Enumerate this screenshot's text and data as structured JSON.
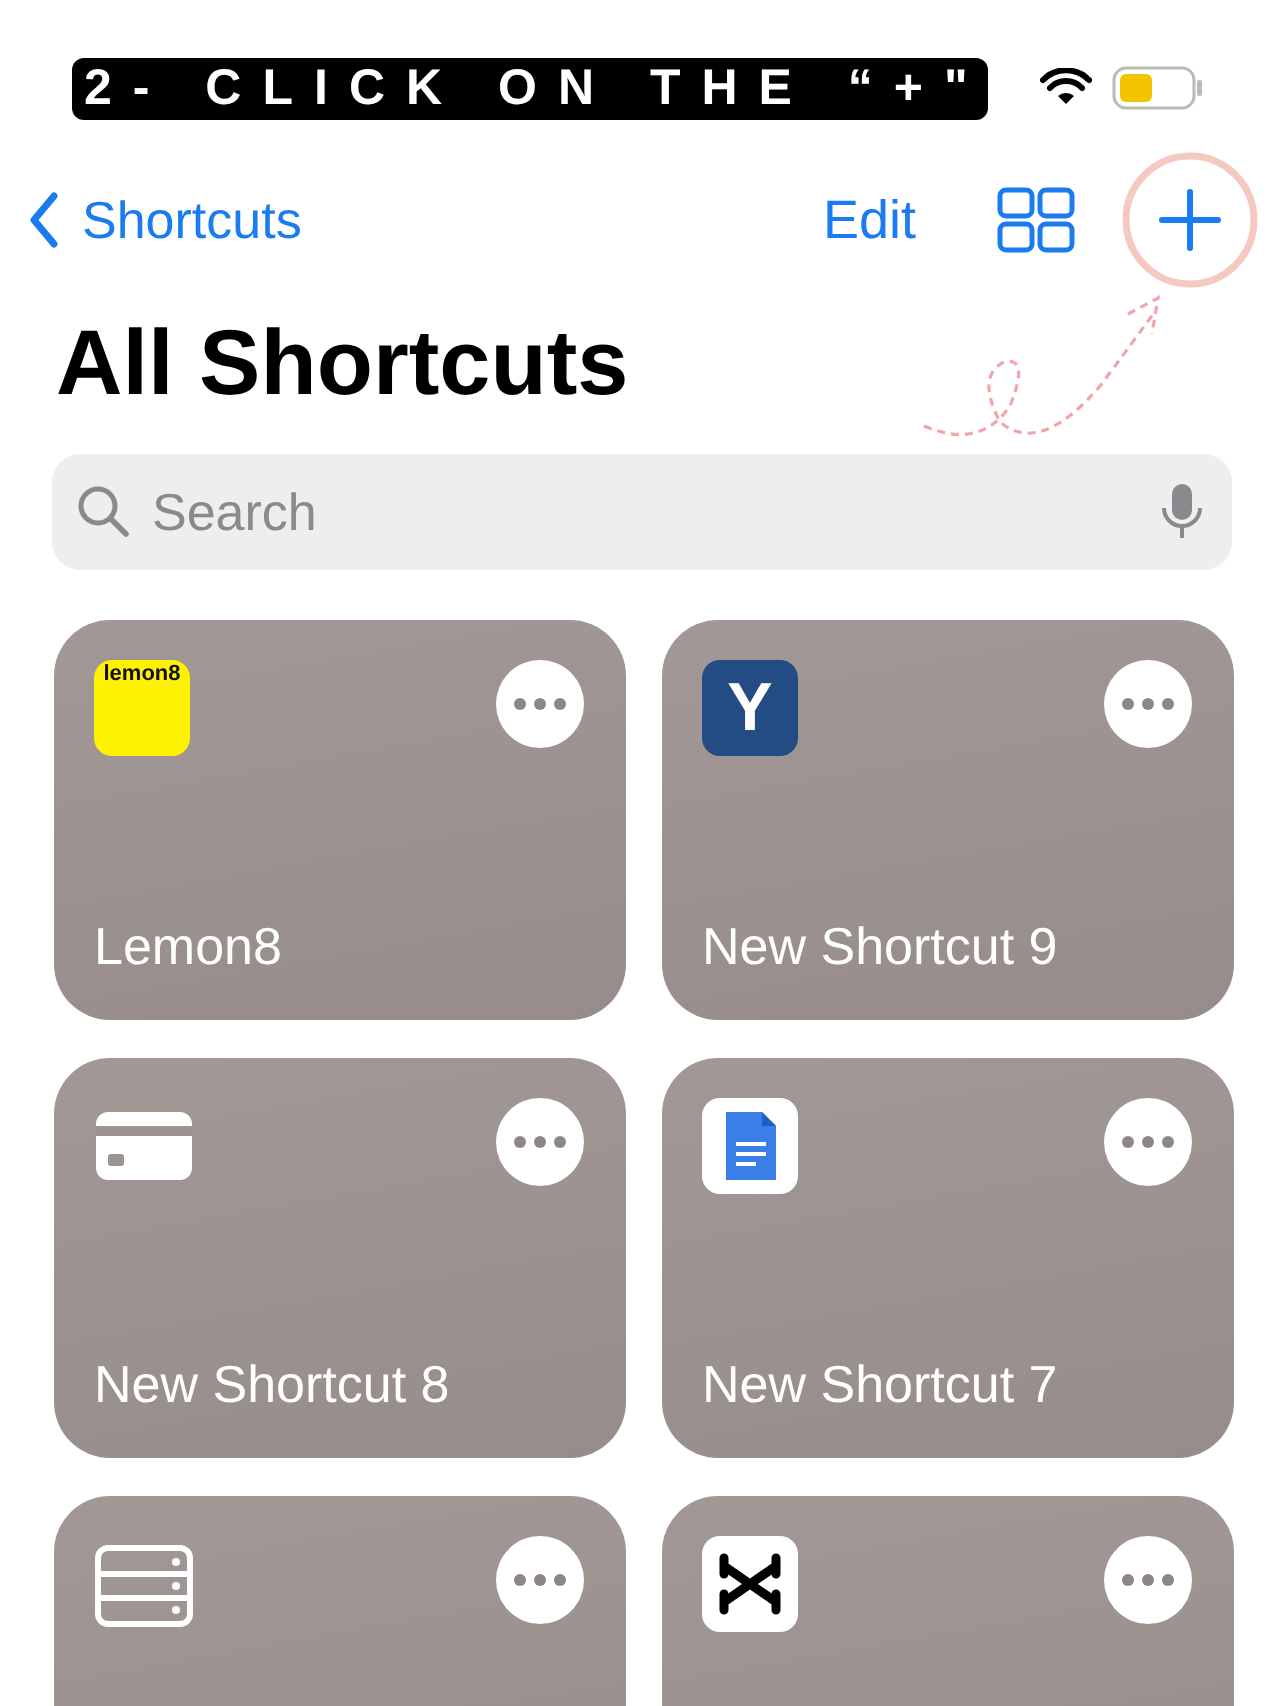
{
  "caption": "2- CLICK ON THE “+\"",
  "nav": {
    "back_label": "Shortcuts",
    "edit_label": "Edit"
  },
  "title": "All Shortcuts",
  "search": {
    "placeholder": "Search"
  },
  "shortcuts": [
    {
      "name": "Lemon8",
      "kind": "lemon",
      "icon_text": "lemon8"
    },
    {
      "name": "New Shortcut 9",
      "kind": "bolt",
      "icon_text": "Y"
    },
    {
      "name": "New Shortcut 8",
      "kind": "card"
    },
    {
      "name": "New Shortcut 7",
      "kind": "doc"
    },
    {
      "kind": "storage"
    },
    {
      "kind": "capcut"
    }
  ]
}
